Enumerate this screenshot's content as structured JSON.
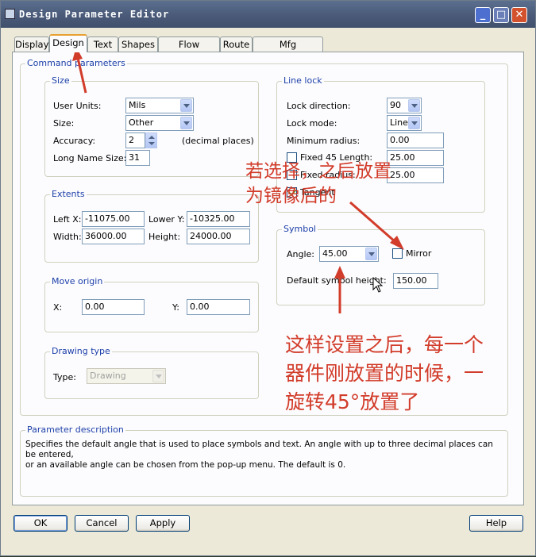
{
  "window": {
    "title": "Design Parameter Editor",
    "min_glyph": "_",
    "max_glyph": "□",
    "close_glyph": "✕"
  },
  "tabs": [
    "Display",
    "Design",
    "Text",
    "Shapes",
    "Flow Planning",
    "Route",
    "Mfg Applications"
  ],
  "active_tab": "Design",
  "command_parameters": {
    "title": "Command parameters",
    "size": {
      "title": "Size",
      "user_units_label": "User Units:",
      "user_units_value": "Mils",
      "size_label": "Size:",
      "size_value": "Other",
      "accuracy_label": "Accuracy:",
      "accuracy_value": "2",
      "accuracy_unit": "(decimal places)",
      "long_name_label": "Long Name Size:",
      "long_name_value": "31"
    },
    "extents": {
      "title": "Extents",
      "left_x_label": "Left X:",
      "left_x_value": "-11075.00",
      "lower_y_label": "Lower Y:",
      "lower_y_value": "-10325.00",
      "width_label": "Width:",
      "width_value": "36000.00",
      "height_label": "Height:",
      "height_value": "24000.00"
    },
    "move_origin": {
      "title": "Move origin",
      "x_label": "X:",
      "x_value": "0.00",
      "y_label": "Y:",
      "y_value": "0.00"
    },
    "drawing_type": {
      "title": "Drawing type",
      "type_label": "Type:",
      "type_value": "Drawing"
    },
    "line_lock": {
      "title": "Line lock",
      "lock_direction_label": "Lock direction:",
      "lock_direction_value": "90",
      "lock_mode_label": "Lock mode:",
      "lock_mode_value": "Line",
      "min_radius_label": "Minimum radius:",
      "min_radius_value": "0.00",
      "fixed45_label": "Fixed 45 Length:",
      "fixed45_value": "25.00",
      "fixed_radius_label": "Fixed radius:",
      "fixed_radius_value": "25.00",
      "tangent_label": "Tangent"
    },
    "symbol": {
      "title": "Symbol",
      "angle_label": "Angle:",
      "angle_value": "45.00",
      "mirror_label": "Mirror",
      "default_height_label": "Default symbol height:",
      "default_height_value": "150.00"
    }
  },
  "parameter_description": {
    "title": "Parameter description",
    "line1": "Specifies the default angle that is used to place symbols and text. An angle with up to three decimal places can be entered,",
    "line2": "or an available angle can be chosen from the pop-up menu. The default is 0."
  },
  "buttons": {
    "ok": "OK",
    "cancel": "Cancel",
    "apply": "Apply",
    "help": "Help"
  },
  "annotations": {
    "mirror_note_line1": "若选择，之后放置",
    "mirror_note_line2": "为镜像后的",
    "angle_note_line1": "这样设置之后，每一个",
    "angle_note_line2": "器件刚放置的时候，一",
    "angle_note_line3": "旋转45°放置了"
  },
  "colors": {
    "annotation": "#d23c2a",
    "group_title": "#1c3fa8",
    "titlebar": "#4a5a78"
  }
}
